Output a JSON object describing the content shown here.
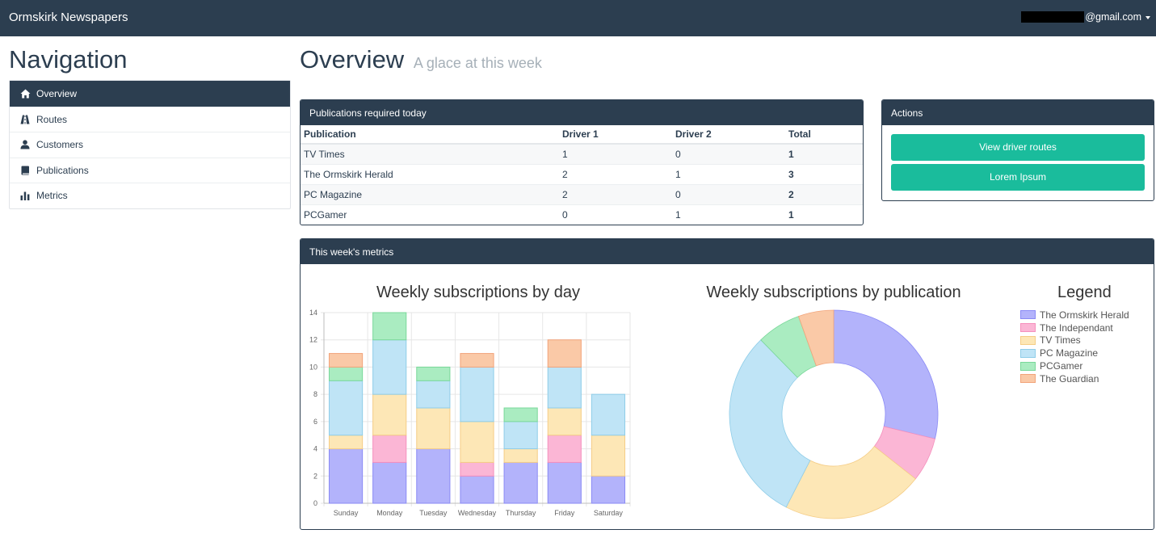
{
  "navbar": {
    "brand": "Ormskirk Newspapers",
    "user_email": "@gmail.com"
  },
  "sidebar": {
    "title": "Navigation",
    "items": [
      {
        "label": "Overview",
        "icon": "home-icon",
        "active": true
      },
      {
        "label": "Routes",
        "icon": "road-icon",
        "active": false
      },
      {
        "label": "Customers",
        "icon": "user-icon",
        "active": false
      },
      {
        "label": "Publications",
        "icon": "book-icon",
        "active": false
      },
      {
        "label": "Metrics",
        "icon": "bar-chart-icon",
        "active": false
      }
    ]
  },
  "page": {
    "title": "Overview",
    "subtitle": "A glace at this week"
  },
  "publications_panel": {
    "title": "Publications required today",
    "columns": [
      "Publication",
      "Driver 1",
      "Driver 2",
      "Total"
    ],
    "rows": [
      [
        "TV Times",
        "1",
        "0",
        "1"
      ],
      [
        "The Ormskirk Herald",
        "2",
        "1",
        "3"
      ],
      [
        "PC Magazine",
        "2",
        "0",
        "2"
      ],
      [
        "PCGamer",
        "0",
        "1",
        "1"
      ]
    ]
  },
  "actions_panel": {
    "title": "Actions",
    "buttons": [
      "View driver routes",
      "Lorem Ipsum"
    ]
  },
  "metrics_panel": {
    "title": "This week's metrics",
    "legend_title": "Legend"
  },
  "colors": {
    "accent": "#1abc9c",
    "navbar": "#2c3e50",
    "series": [
      "#b3b3fb",
      "#fbb6d5",
      "#fde7b6",
      "#bfe4f6",
      "#aaecc1",
      "#fac9a7"
    ],
    "series_stroke": [
      "#8a8af5",
      "#f590bd",
      "#f5cd86",
      "#8fcde8",
      "#7ad89a",
      "#f2a47a"
    ]
  },
  "chart_data": [
    {
      "type": "bar",
      "stacked": true,
      "title": "Weekly subscriptions by day",
      "categories": [
        "Sunday",
        "Monday",
        "Tuesday",
        "Wednesday",
        "Thursday",
        "Friday",
        "Saturday"
      ],
      "series": [
        {
          "name": "The Ormskirk Herald",
          "values": [
            4,
            3,
            4,
            2,
            3,
            3,
            2
          ]
        },
        {
          "name": "The Independant",
          "values": [
            0,
            2,
            0,
            1,
            0,
            2,
            0
          ]
        },
        {
          "name": "TV Times",
          "values": [
            1,
            3,
            3,
            3,
            1,
            2,
            3
          ]
        },
        {
          "name": "PC Magazine",
          "values": [
            4,
            4,
            2,
            4,
            2,
            3,
            3
          ]
        },
        {
          "name": "PCGamer",
          "values": [
            1,
            2,
            1,
            0,
            1,
            0,
            0
          ]
        },
        {
          "name": "The Guardian",
          "values": [
            1,
            0,
            0,
            1,
            0,
            2,
            0
          ]
        }
      ],
      "ylim": [
        0,
        14
      ],
      "yticks": [
        0,
        2,
        4,
        6,
        8,
        10,
        12,
        14
      ],
      "grid": true
    },
    {
      "type": "pie",
      "donut": true,
      "title": "Weekly subscriptions by publication",
      "labels": [
        "The Ormskirk Herald",
        "The Independant",
        "TV Times",
        "PC Magazine",
        "PCGamer",
        "The Guardian"
      ],
      "values": [
        21,
        5,
        16,
        22,
        5,
        4
      ],
      "legend_position": "right"
    }
  ]
}
